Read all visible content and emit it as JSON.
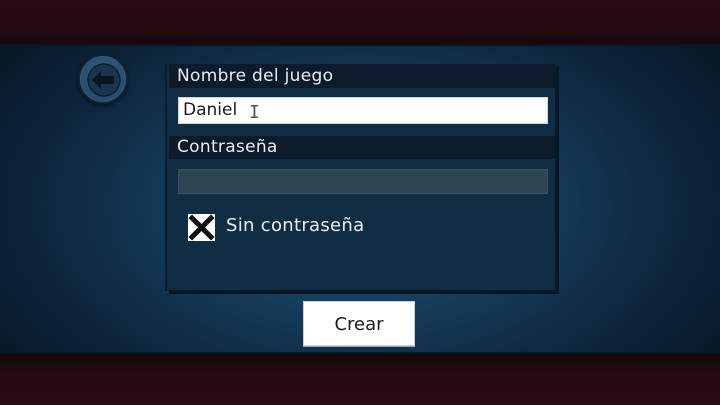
{
  "form": {
    "name_label": "Nombre del juego",
    "name_value": "Daniel",
    "password_label": "Contraseña",
    "password_value": "",
    "no_password_checkbox": {
      "label": "Sin contraseña",
      "checked": true
    }
  },
  "buttons": {
    "back_icon": "back-arrow-icon",
    "create_label": "Crear"
  },
  "colors": {
    "background_center": "#1f4f6e",
    "panel": "#112d44",
    "label_bar": "#0c1a2a",
    "band": "#2a0d14"
  }
}
